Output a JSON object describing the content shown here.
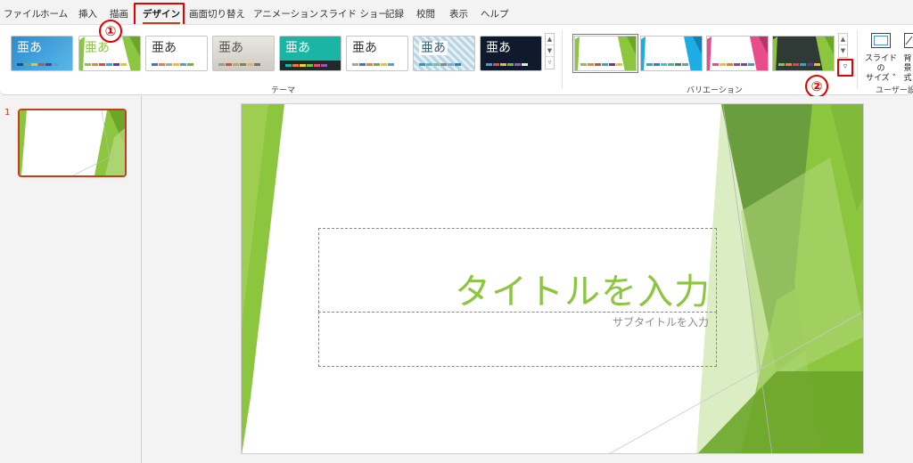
{
  "menu": {
    "tabs": [
      {
        "label": "ファイル"
      },
      {
        "label": "ホーム"
      },
      {
        "label": "挿入"
      },
      {
        "label": "描画"
      },
      {
        "label": "デザイン"
      },
      {
        "label": "画面切り替え"
      },
      {
        "label": "アニメーション"
      },
      {
        "label": "スライド ショー"
      },
      {
        "label": "記録"
      },
      {
        "label": "校閲"
      },
      {
        "label": "表示"
      },
      {
        "label": "ヘルプ"
      }
    ],
    "active_tab": "デザイン"
  },
  "annotations": {
    "step1": "①",
    "step2": "②",
    "color": "#e30000"
  },
  "ribbon": {
    "themes_group_label": "テーマ",
    "variations_group_label": "バリエーション",
    "custom_group_label": "ユーザー設",
    "themes": [
      {
        "text": "亜あ",
        "name": "theme-blue"
      },
      {
        "text": "亜あ",
        "name": "theme-green-facet"
      },
      {
        "text": "亜あ",
        "name": "theme-office"
      },
      {
        "text": "亜あ",
        "name": "theme-gray-texture"
      },
      {
        "text": "亜あ",
        "name": "theme-teal"
      },
      {
        "text": "亜あ",
        "name": "theme-white"
      },
      {
        "text": "亜あ",
        "name": "theme-pattern"
      },
      {
        "text": "亜あ",
        "name": "theme-dark-blue"
      }
    ],
    "slide_size_label_1": "スライドの",
    "slide_size_label_2": "サイズ ˅",
    "background_label_1": "背景",
    "background_label_2": "式"
  },
  "thumbnails": {
    "slide_number": "1"
  },
  "slide": {
    "title": "タイトルを入力",
    "subtitle": "サブタイトルを入力",
    "accent": "#8cc63f"
  }
}
